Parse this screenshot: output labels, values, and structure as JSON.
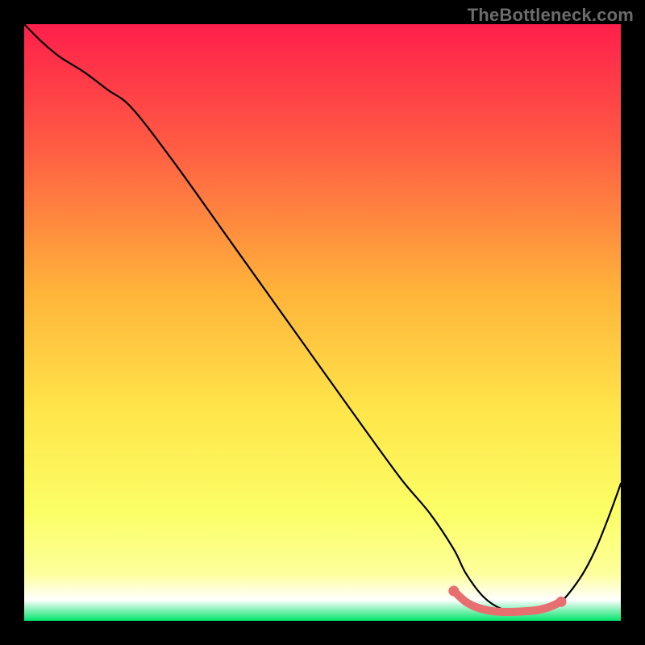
{
  "watermark": "TheBottleneck.com",
  "chart_data": {
    "type": "line",
    "title": "",
    "xlabel": "",
    "ylabel": "",
    "xlim": [
      0,
      100
    ],
    "ylim": [
      0,
      100
    ],
    "grid": false,
    "legend": false,
    "gradient_stops": [
      {
        "offset": 0.0,
        "color": "#ff1f4b"
      },
      {
        "offset": 0.2,
        "color": "#ff5a44"
      },
      {
        "offset": 0.45,
        "color": "#ffb43a"
      },
      {
        "offset": 0.65,
        "color": "#ffe64a"
      },
      {
        "offset": 0.82,
        "color": "#fbff66"
      },
      {
        "offset": 0.92,
        "color": "#fdff9a"
      },
      {
        "offset": 0.965,
        "color": "#ffffff"
      },
      {
        "offset": 1.0,
        "color": "#00e56a"
      }
    ],
    "series": [
      {
        "name": "bottleneck-curve",
        "color": "#000000",
        "x": [
          0,
          3,
          6,
          10,
          14,
          18,
          25,
          35,
          45,
          55,
          63,
          68,
          72,
          74,
          77,
          80,
          83,
          86,
          88,
          90,
          92,
          94,
          96,
          98,
          100
        ],
        "y": [
          100,
          97,
          94.5,
          92,
          89,
          86,
          77,
          63,
          49,
          35,
          24,
          18,
          12,
          8,
          4,
          2,
          1.5,
          1.6,
          2.0,
          3.2,
          5.5,
          8.5,
          12.5,
          17.5,
          23
        ]
      },
      {
        "name": "highlight-band",
        "color": "#e76f6f",
        "marker": true,
        "x": [
          72,
          74,
          76,
          78,
          80,
          82,
          84,
          86,
          88,
          90
        ],
        "y": [
          5.0,
          3.2,
          2.2,
          1.7,
          1.5,
          1.5,
          1.6,
          1.8,
          2.3,
          3.2
        ]
      }
    ]
  }
}
